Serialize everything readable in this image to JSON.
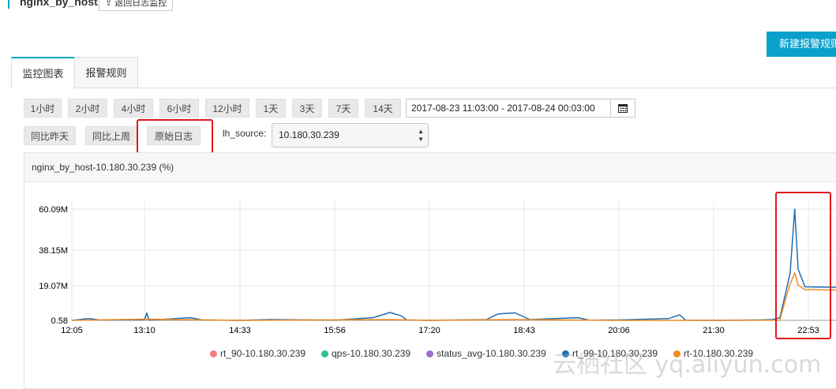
{
  "header": {
    "title": "nginx_by_host",
    "back_label": "返回日志监控"
  },
  "toolbar": {
    "new_alarm_label": "新建报警规则"
  },
  "tabs": [
    {
      "label": "监控图表",
      "active": true
    },
    {
      "label": "报警规则",
      "active": false
    }
  ],
  "time_ranges": [
    "1小时",
    "2小时",
    "4小时",
    "6小时",
    "12小时",
    "1天",
    "3天",
    "7天",
    "14天"
  ],
  "date_range": "2017-08-23 11:03:00 - 2017-08-24 00:03:00",
  "compare_buttons": [
    "同比昨天",
    "同比上周",
    "原始日志"
  ],
  "filter": {
    "label": "lh_source:",
    "value": "10.180.30.239"
  },
  "chart_data": {
    "type": "line",
    "title": "nginx_by_host-10.180.30.239 (%)",
    "y_ticks": [
      "60.09M",
      "38.15M",
      "19.07M",
      "0.58"
    ],
    "ylim": [
      0.58,
      60.09
    ],
    "x_ticks": [
      "12:05",
      "13:10",
      "14:33",
      "15:56",
      "17:20",
      "18:43",
      "20:06",
      "21:30",
      "22:53"
    ],
    "grid": true,
    "legend_placement": "bottom",
    "series": [
      {
        "name": "rt_90-10.180.30.239",
        "color": "#f08080",
        "values": []
      },
      {
        "name": "qps-10.180.30.239",
        "color": "#2fc493",
        "values": []
      },
      {
        "name": "status_avg-10.180.30.239",
        "color": "#a070c8",
        "values": []
      },
      {
        "name": "rt_99-10.180.30.239",
        "color": "#1f6fb2",
        "points": [
          [
            "12:05",
            0.6
          ],
          [
            "12:20",
            1.5
          ],
          [
            "12:30",
            0.8
          ],
          [
            "13:10",
            0.9
          ],
          [
            "13:12",
            4.5
          ],
          [
            "13:14",
            0.7
          ],
          [
            "13:50",
            2.0
          ],
          [
            "14:00",
            0.8
          ],
          [
            "14:33",
            0.6
          ],
          [
            "15:00",
            1.0
          ],
          [
            "15:56",
            0.7
          ],
          [
            "16:30",
            2.0
          ],
          [
            "16:45",
            4.8
          ],
          [
            "16:55",
            3.0
          ],
          [
            "17:00",
            0.8
          ],
          [
            "17:20",
            0.6
          ],
          [
            "18:10",
            1.0
          ],
          [
            "18:20",
            4.0
          ],
          [
            "18:35",
            4.6
          ],
          [
            "18:48",
            1.0
          ],
          [
            "19:30",
            2.0
          ],
          [
            "19:40",
            0.7
          ],
          [
            "20:06",
            0.8
          ],
          [
            "20:50",
            1.5
          ],
          [
            "21:00",
            3.5
          ],
          [
            "21:05",
            0.7
          ],
          [
            "21:30",
            0.6
          ],
          [
            "22:10",
            0.8
          ],
          [
            "22:22",
            1.0
          ],
          [
            "22:28",
            2.0
          ],
          [
            "22:33",
            15.0
          ],
          [
            "22:37",
            26.0
          ],
          [
            "22:41",
            60.09
          ],
          [
            "22:44",
            28.0
          ],
          [
            "22:50",
            18.5
          ],
          [
            "23:00",
            18.4
          ],
          [
            "23:30",
            18.3
          ]
        ]
      },
      {
        "name": "rt-10.180.30.239",
        "color": "#f08a1e",
        "points": [
          [
            "12:05",
            0.6
          ],
          [
            "13:12",
            1.2
          ],
          [
            "14:33",
            0.6
          ],
          [
            "16:45",
            1.0
          ],
          [
            "17:20",
            0.6
          ],
          [
            "18:35",
            1.0
          ],
          [
            "20:06",
            0.6
          ],
          [
            "21:30",
            0.6
          ],
          [
            "22:28",
            0.7
          ],
          [
            "22:33",
            12.0
          ],
          [
            "22:37",
            20.0
          ],
          [
            "22:41",
            26.0
          ],
          [
            "22:44",
            19.5
          ],
          [
            "22:50",
            17.0
          ],
          [
            "23:00",
            16.9
          ],
          [
            "23:30",
            16.8
          ]
        ]
      }
    ]
  },
  "watermark": "云栖社区 yq.aliyun.com",
  "icons": {
    "back": "up-arrow-icon",
    "calendar": "calendar-icon",
    "select": "select-arrows-icon"
  }
}
